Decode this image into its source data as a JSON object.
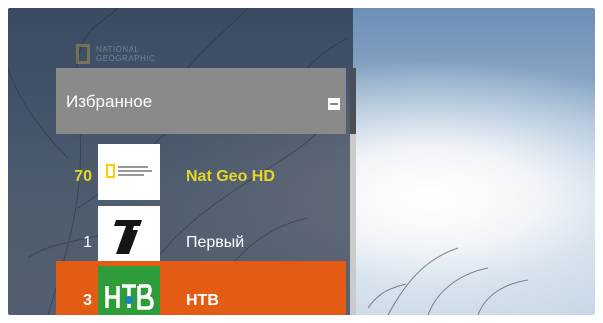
{
  "overlay_logo": {
    "line1": "NATIONAL",
    "line2": "GEOGRAPHIC"
  },
  "favorites": {
    "title": "Избранное"
  },
  "channels": [
    {
      "number": "70",
      "name": "Nat Geo HD",
      "logo_icon": "national-geographic-logo",
      "state": "current"
    },
    {
      "number": "1",
      "name": "Первый",
      "logo_icon": "perviy-kanal-logo",
      "state": "normal"
    },
    {
      "number": "3",
      "name": "НТВ",
      "logo_icon": "ntv-logo",
      "state": "selected"
    }
  ],
  "colors": {
    "current_text": "#e6d629",
    "selected_bg": "#e45b14",
    "header_bg": "#8a8a8a",
    "ntv_logo_bg": "#2f9c3a"
  }
}
